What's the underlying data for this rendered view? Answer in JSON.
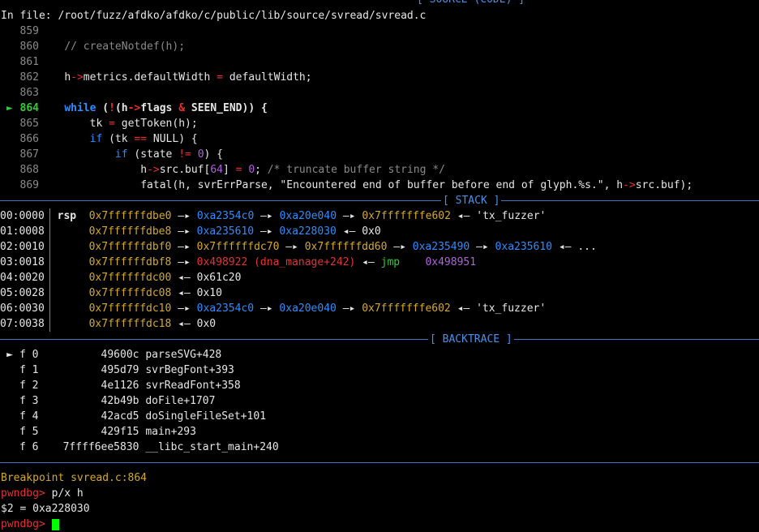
{
  "colors": {
    "blue": "#2f8cff",
    "yellow": "#d5a929",
    "red": "#e83030",
    "green": "#35c935",
    "separator": "#4a74c8"
  },
  "source": {
    "title": "[ SOURCE (CODE) ]",
    "file_line": "In file: /root/fuzz/afdko/afdko/c/public/lib/source/svread/svread.c",
    "lines": [
      {
        "num": "859"
      },
      {
        "num": "860",
        "code": "// createNotdef(h);"
      },
      {
        "num": "861"
      },
      {
        "num": "862",
        "h": "h",
        "arrow": "->",
        "a": "metrics.defaultWidth ",
        "eq": "=",
        "b": " defaultWidth;"
      },
      {
        "num": "863"
      },
      {
        "num": "864",
        "marker": "►",
        "kw": "while",
        "p1": " (",
        "not": "!",
        "p2": "(",
        "h": "h",
        "arrow": "->",
        "flags": "flags",
        "amp": " & ",
        "seen": "SEEN_END",
        "p3": ")) {"
      },
      {
        "num": "865",
        "a": "tk ",
        "eq": "=",
        "b": " getToken(h);"
      },
      {
        "num": "866",
        "kw": "if",
        "a": " (tk ",
        "eq": "==",
        "b": " NULL) {"
      },
      {
        "num": "867",
        "kw": "if",
        "a": " (state ",
        "op": "!=",
        "sp": " ",
        "zero": "0",
        "b": ") {"
      },
      {
        "num": "868",
        "h": "h",
        "arrow": "->",
        "a": "src.buf[",
        "n64": "64",
        "b": "] ",
        "eq": "=",
        "sp": " ",
        "zero": "0",
        "semi": "; ",
        "comment": "/* truncate buffer string */"
      },
      {
        "num": "869",
        "a": "fatal(h, svrErrParse, ",
        "str": "\"Encountered end of buffer before end of glyph.%s.\"",
        "b": ", ",
        "h": "h",
        "arrow": "->",
        "c": "src.buf);"
      }
    ]
  },
  "stack": {
    "title": "[ STACK ]",
    "rows": [
      {
        "idx": "00:0000",
        "reg": "rsp",
        "addr": "0x7ffffffdbe0",
        "a1": "0xa2354c0",
        "a2": "0xa20e040",
        "a3": "0x7fffffffe602",
        "val": "'tx_fuzzer'"
      },
      {
        "idx": "01:0008",
        "addr": "0x7ffffffdbe8",
        "a1": "0xa235610",
        "a2": "0xa228030",
        "val": "0x0"
      },
      {
        "idx": "02:0010",
        "addr": "0x7ffffffdbf0",
        "a1": "0x7ffffffdc70",
        "a2": "0x7ffffffdd60",
        "a3": "0xa235490",
        "a4": "0xa235610",
        "val": "..."
      },
      {
        "idx": "03:0018",
        "addr": "0x7ffffffdbf8",
        "code": "0x498922 (dna_manage+242)",
        "instr": "jmp",
        "target": "0x498951"
      },
      {
        "idx": "04:0020",
        "addr": "0x7ffffffdc00",
        "val": "0x61c20"
      },
      {
        "idx": "05:0028",
        "addr": "0x7ffffffdc08",
        "val": "0x10"
      },
      {
        "idx": "06:0030",
        "addr": "0x7ffffffdc10",
        "a1": "0xa2354c0",
        "a2": "0xa20e040",
        "a3": "0x7fffffffe602",
        "val": "'tx_fuzzer'"
      },
      {
        "idx": "07:0038",
        "addr": "0x7ffffffdc18",
        "val": "0x0"
      }
    ],
    "right_arrow": "—▸",
    "left_arrow": "◂—"
  },
  "backtrace": {
    "title": "[ BACKTRACE ]",
    "frames": [
      {
        "marker": "►",
        "frame": "f 0",
        "addr": "49600c",
        "sym": "parseSVG+428"
      },
      {
        "frame": "f 1",
        "addr": "495d79",
        "sym": "svrBegFont+393"
      },
      {
        "frame": "f 2",
        "addr": "4e1126",
        "sym": "svrReadFont+358"
      },
      {
        "frame": "f 3",
        "addr": "42b49b",
        "sym": "doFile+1707"
      },
      {
        "frame": "f 4",
        "addr": "42acd5",
        "sym": "doSingleFileSet+101"
      },
      {
        "frame": "f 5",
        "addr": "429f15",
        "sym": "main+293"
      },
      {
        "frame": "f 6",
        "addr": "7ffff6ee5830",
        "sym": "__libc_start_main+240"
      }
    ]
  },
  "console": {
    "breakpoint": "Breakpoint svread.c:864",
    "prompt": "pwndbg>",
    "command": "p/x h",
    "result": "$2 = 0xa228030",
    "prompt2": "pwndbg>"
  }
}
